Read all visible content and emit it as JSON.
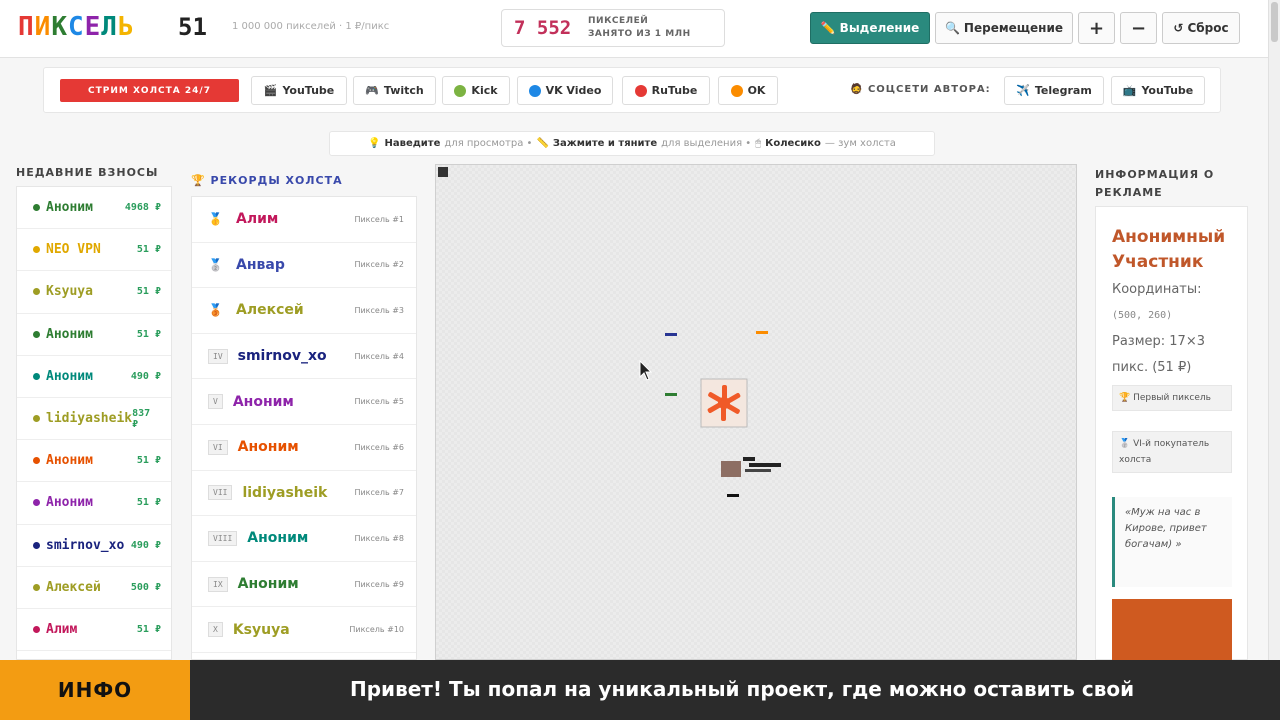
{
  "header": {
    "logo_letters": [
      "П",
      "И",
      "К",
      "С",
      "Е",
      "Л",
      "Ь"
    ],
    "logo_colors": [
      "#e53935",
      "#fb8c00",
      "#2e7d32",
      "#1e88e5",
      "#8e24aa",
      "#00897b",
      "#f4b400"
    ],
    "price": "51",
    "subtitle": "1 000 000 пикселей · 1 ₽/пикс",
    "counter_value": "7 552",
    "counter_label_1": "ПИКСЕЛЕЙ",
    "counter_label_2": "ЗАНЯТО ИЗ 1 МЛН",
    "btn_select": "Выделение",
    "btn_move": "Перемещение",
    "btn_plus": "+",
    "btn_minus": "−",
    "btn_reset": "Сброс"
  },
  "streams": {
    "live_label": "СТРИМ ХОЛСТА 24/7",
    "buttons": [
      {
        "label": "YouTube",
        "icon": "film-icon"
      },
      {
        "label": "Twitch",
        "icon": "gamepad-icon"
      },
      {
        "label": "Kick",
        "color": "#7cb342"
      },
      {
        "label": "VK Video",
        "color": "#1e88e5"
      },
      {
        "label": "RuTube",
        "color": "#e53935"
      },
      {
        "label": "OK",
        "color": "#fb8c00"
      }
    ],
    "social_label": "СОЦСЕТИ АВТОРА:",
    "social_buttons": [
      {
        "label": "Telegram",
        "icon": "plane-icon"
      },
      {
        "label": "YouTube",
        "icon": "tv-icon"
      }
    ]
  },
  "hint": {
    "a_bold": "Наведите",
    "a_text": "для просмотра •",
    "b_bold": "Зажмите и тяните",
    "c_text": "для выделения •",
    "d_bold": "Колесико",
    "d_text": "— зум холста"
  },
  "recent": {
    "title": "НЕДАВНИЕ ВЗНОСЫ",
    "items": [
      {
        "name": "Аноним",
        "amount": "4968 ₽",
        "color": "#2e7d32"
      },
      {
        "name": "NEO VPN",
        "amount": "51 ₽",
        "color": "#e0a800"
      },
      {
        "name": "Ksyuya",
        "amount": "51 ₽",
        "color": "#9e9d24"
      },
      {
        "name": "Аноним",
        "amount": "51 ₽",
        "color": "#2e7d32"
      },
      {
        "name": "Аноним",
        "amount": "490 ₽",
        "color": "#00897b"
      },
      {
        "name": "lidiyasheik",
        "amount": "837 ₽",
        "color": "#9e9d24"
      },
      {
        "name": "Аноним",
        "amount": "51 ₽",
        "color": "#e65100"
      },
      {
        "name": "Аноним",
        "amount": "51 ₽",
        "color": "#8e24aa"
      },
      {
        "name": "smirnov_xo",
        "amount": "490 ₽",
        "color": "#1a237e"
      },
      {
        "name": "Алексей",
        "amount": "500 ₽",
        "color": "#9e9d24"
      },
      {
        "name": "Алим",
        "amount": "51 ₽",
        "color": "#c2185b"
      }
    ]
  },
  "records": {
    "title": "РЕКОРДЫ ХОЛСТА",
    "items": [
      {
        "rank": "🥇",
        "name": "Алим",
        "pixel": "Пиксель #1",
        "color": "#c2185b"
      },
      {
        "rank": "🥈",
        "name": "Анвар",
        "pixel": "Пиксель #2",
        "color": "#3949ab"
      },
      {
        "rank": "🥉",
        "name": "Алексей",
        "pixel": "Пиксель #3",
        "color": "#9e9d24"
      },
      {
        "rank": "IV",
        "name": "smirnov_xo",
        "pixel": "Пиксель #4",
        "color": "#1a237e"
      },
      {
        "rank": "V",
        "name": "Аноним",
        "pixel": "Пиксель #5",
        "color": "#8e24aa"
      },
      {
        "rank": "VI",
        "name": "Аноним",
        "pixel": "Пиксель #6",
        "color": "#e65100"
      },
      {
        "rank": "VII",
        "name": "lidiyasheik",
        "pixel": "Пиксель #7",
        "color": "#9e9d24"
      },
      {
        "rank": "VIII",
        "name": "Аноним",
        "pixel": "Пиксель #8",
        "color": "#00897b"
      },
      {
        "rank": "IX",
        "name": "Аноним",
        "pixel": "Пиксель #9",
        "color": "#2e7d32"
      },
      {
        "rank": "X",
        "name": "Ksyuya",
        "pixel": "Пиксель #10",
        "color": "#9e9d24"
      }
    ]
  },
  "ad": {
    "title_1": "ИНФОРМАЦИЯ О",
    "title_2": "РЕКЛАМЕ",
    "name": "Анонимный Участник",
    "coords_label": "Координаты:",
    "coords_value": "(500, 260)",
    "size_label": "Размер: 17×3",
    "size_value": "пикс. (51 ₽)",
    "badge_1": "🏆 Первый пиксель",
    "badge_2": "🥈 VI-й покупатель холста",
    "quote": "«Муж на час в Кирове, привет богачам) »"
  },
  "footer": {
    "tag": "ИНФО",
    "ticker": "Привет! Ты попал на уникальный проект, где можно оставить свой"
  }
}
